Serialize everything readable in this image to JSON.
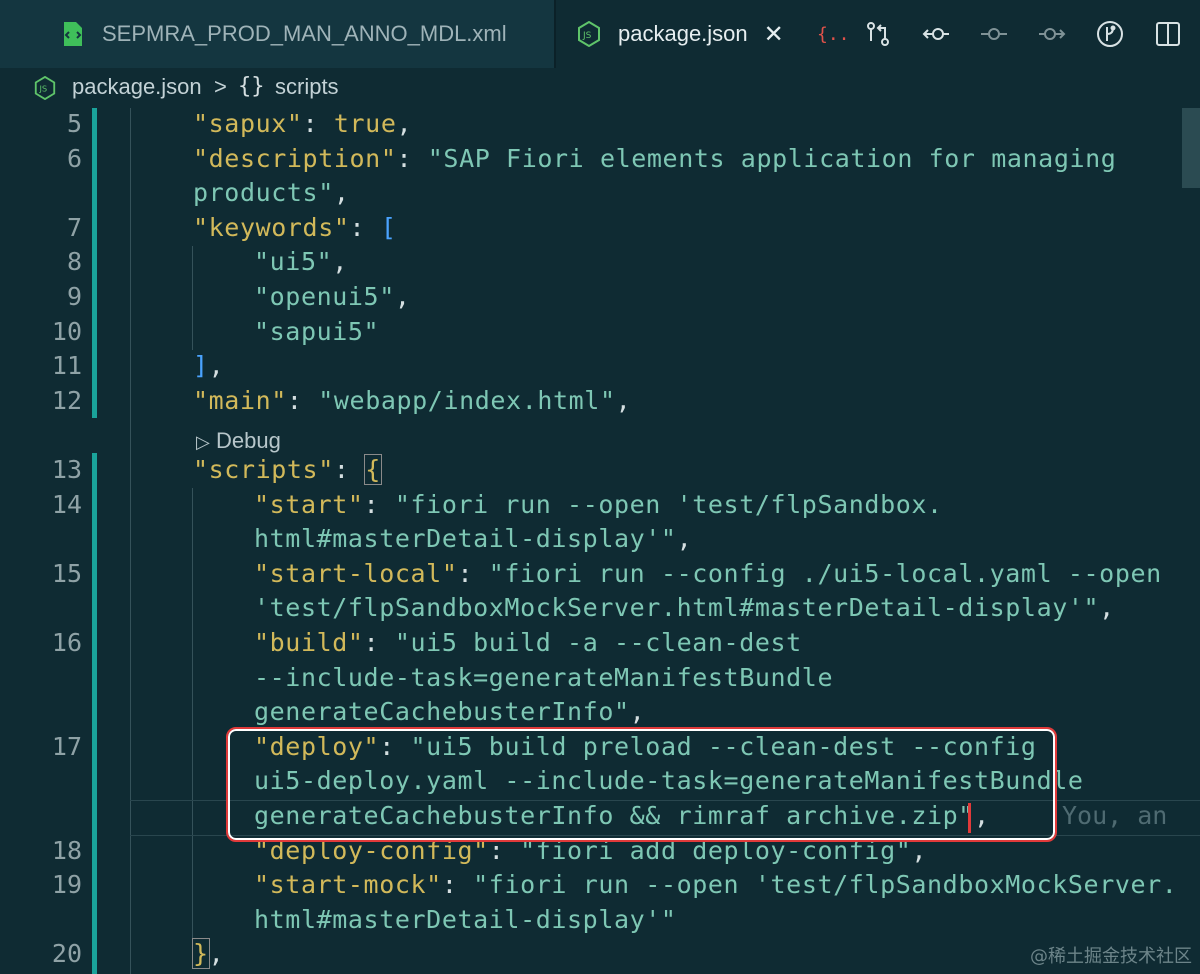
{
  "tabs": [
    {
      "label": "SEPMRA_PROD_MAN_ANNO_MDL.xml",
      "active": false,
      "icon": "xml-file-icon"
    },
    {
      "label": "package.json",
      "active": true,
      "icon": "nodejs-file-icon"
    }
  ],
  "breadcrumb": {
    "file": "package.json",
    "separator": ">",
    "symbol": "{}",
    "section": "scripts"
  },
  "toolbar_icons": [
    "json-braces-icon",
    "compare-changes-icon",
    "go-back-icon",
    "commit-dot-icon",
    "go-forward-icon",
    "git-graph-icon",
    "split-editor-icon"
  ],
  "codelens": {
    "label": "Debug"
  },
  "lines": [
    {
      "n": "5",
      "parts": [
        [
          "k",
          "\"sapux\""
        ],
        [
          "p",
          ": "
        ],
        [
          "kw",
          "true"
        ],
        [
          "p",
          ","
        ]
      ]
    },
    {
      "n": "6",
      "parts": [
        [
          "k",
          "\"description\""
        ],
        [
          "p",
          ": "
        ],
        [
          "s",
          "\"SAP Fiori elements application for managing"
        ]
      ]
    },
    {
      "n": "",
      "parts": [
        [
          "s",
          "products\""
        ],
        [
          "p",
          ","
        ]
      ]
    },
    {
      "n": "7",
      "parts": [
        [
          "k",
          "\"keywords\""
        ],
        [
          "p",
          ": "
        ],
        [
          "br",
          "["
        ]
      ]
    },
    {
      "n": "8",
      "parts": [
        [
          "s",
          "\"ui5\""
        ],
        [
          "p",
          ","
        ]
      ]
    },
    {
      "n": "9",
      "parts": [
        [
          "s",
          "\"openui5\""
        ],
        [
          "p",
          ","
        ]
      ]
    },
    {
      "n": "10",
      "parts": [
        [
          "s",
          "\"sapui5\""
        ]
      ]
    },
    {
      "n": "11",
      "parts": [
        [
          "br",
          "]"
        ],
        [
          "p",
          ","
        ]
      ]
    },
    {
      "n": "12",
      "parts": [
        [
          "k",
          "\"main\""
        ],
        [
          "p",
          ": "
        ],
        [
          "s",
          "\"webapp/index.html\""
        ],
        [
          "p",
          ","
        ]
      ]
    },
    {
      "n": "13",
      "parts": [
        [
          "k",
          "\"scripts\""
        ],
        [
          "p",
          ": "
        ],
        [
          "brace",
          "{"
        ]
      ]
    },
    {
      "n": "14",
      "parts": [
        [
          "k",
          "\"start\""
        ],
        [
          "p",
          ": "
        ],
        [
          "s",
          "\"fiori run --open 'test/flpSandbox."
        ]
      ]
    },
    {
      "n": "",
      "parts": [
        [
          "s",
          "html#masterDetail-display'\""
        ],
        [
          "p",
          ","
        ]
      ]
    },
    {
      "n": "15",
      "parts": [
        [
          "k",
          "\"start-local\""
        ],
        [
          "p",
          ": "
        ],
        [
          "s",
          "\"fiori run --config ./ui5-local.yaml --open"
        ]
      ]
    },
    {
      "n": "",
      "parts": [
        [
          "s",
          "'test/flpSandboxMockServer.html#masterDetail-display'\""
        ],
        [
          "p",
          ","
        ]
      ]
    },
    {
      "n": "16",
      "parts": [
        [
          "k",
          "\"build\""
        ],
        [
          "p",
          ": "
        ],
        [
          "s",
          "\"ui5 build -a --clean-dest"
        ]
      ]
    },
    {
      "n": "",
      "parts": [
        [
          "s",
          "--include-task=generateManifestBundle"
        ]
      ]
    },
    {
      "n": "",
      "parts": [
        [
          "s",
          "generateCachebusterInfo\""
        ],
        [
          "p",
          ","
        ]
      ]
    },
    {
      "n": "17",
      "parts": [
        [
          "k",
          "\"deploy\""
        ],
        [
          "p",
          ": "
        ],
        [
          "s",
          "\"ui5 build preload --clean-dest --config"
        ]
      ]
    },
    {
      "n": "",
      "parts": [
        [
          "s",
          "ui5-deploy.yaml --include-task=generateManifestBundle"
        ]
      ]
    },
    {
      "n": "",
      "parts": [
        [
          "s",
          "generateCachebusterInfo && rimraf archive.zip\""
        ],
        [
          "p",
          ","
        ]
      ]
    },
    {
      "n": "18",
      "parts": [
        [
          "k",
          "\"deploy-config\""
        ],
        [
          "p",
          ": "
        ],
        [
          "s",
          "\"fiori add deploy-config\""
        ],
        [
          "p",
          ","
        ]
      ]
    },
    {
      "n": "19",
      "parts": [
        [
          "k",
          "\"start-mock\""
        ],
        [
          "p",
          ": "
        ],
        [
          "s",
          "\"fiori run --open 'test/flpSandboxMockServer."
        ]
      ]
    },
    {
      "n": "",
      "parts": [
        [
          "s",
          "html#masterDetail-display'\""
        ]
      ]
    },
    {
      "n": "20",
      "parts": [
        [
          "brace",
          "}"
        ],
        [
          "p",
          ","
        ]
      ]
    }
  ],
  "ghost_text": "You, an",
  "watermark": "@稀土掘金技术社区",
  "colors": {
    "background": "#0f2b33",
    "key": "#d2b95a",
    "string": "#7ec7b4",
    "bracket": "#4aa3ff",
    "highlight_border": "#e03a3a",
    "gutter_bar": "#1aa39a"
  }
}
